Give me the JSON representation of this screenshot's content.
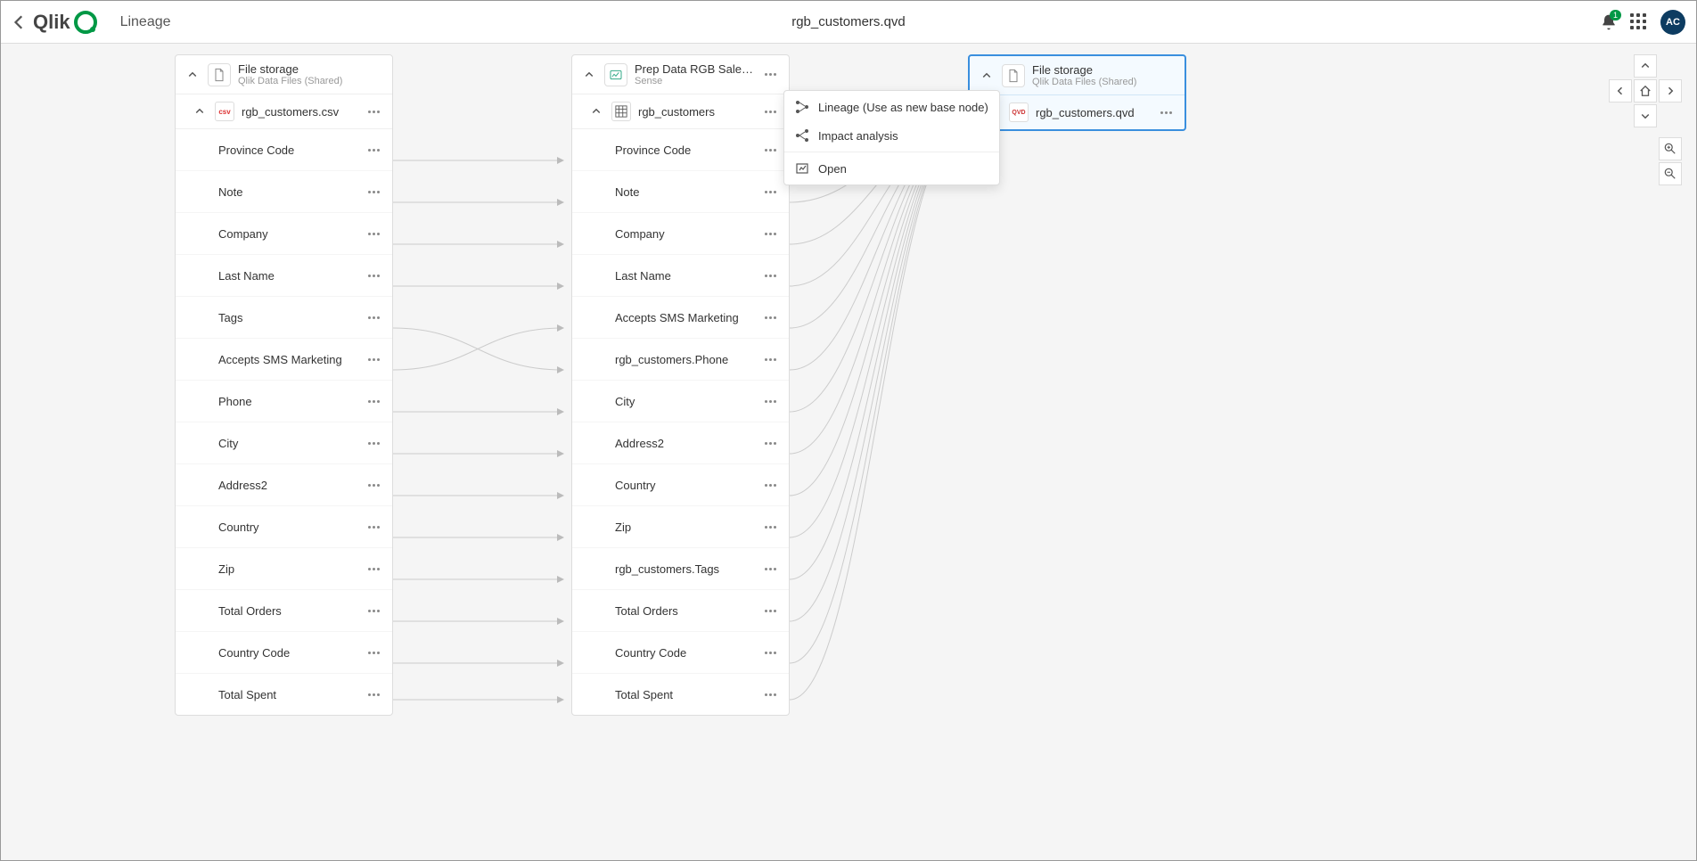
{
  "header": {
    "logo_text": "Qlik",
    "page_title": "Lineage",
    "center_title": "rgb_customers.qvd",
    "notification_count": "1",
    "avatar_initials": "AC"
  },
  "nodes": {
    "left": {
      "title": "File storage",
      "subtitle": "Qlik Data Files (Shared)",
      "sub_label": "rgb_customers.csv",
      "sub_badge": "csv",
      "fields": [
        "Province Code",
        "Note",
        "Company",
        "Last Name",
        "Tags",
        "Accepts SMS Marketing",
        "Phone",
        "City",
        "Address2",
        "Country",
        "Zip",
        "Total Orders",
        "Country Code",
        "Total Spent"
      ]
    },
    "middle": {
      "title": "Prep Data RGB Sales A…",
      "subtitle": "Sense",
      "sub_label": "rgb_customers",
      "fields": [
        "Province Code",
        "Note",
        "Company",
        "Last Name",
        "Accepts SMS Marketing",
        "rgb_customers.Phone",
        "City",
        "Address2",
        "Country",
        "Zip",
        "rgb_customers.Tags",
        "Total Orders",
        "Country Code",
        "Total Spent"
      ]
    },
    "right": {
      "title": "File storage",
      "subtitle": "Qlik Data Files (Shared)",
      "sub_label": "rgb_customers.qvd",
      "sub_badge": "QVD"
    }
  },
  "context_menu": {
    "item1": "Lineage (Use as new base node)",
    "item2": "Impact analysis",
    "item3": "Open"
  }
}
